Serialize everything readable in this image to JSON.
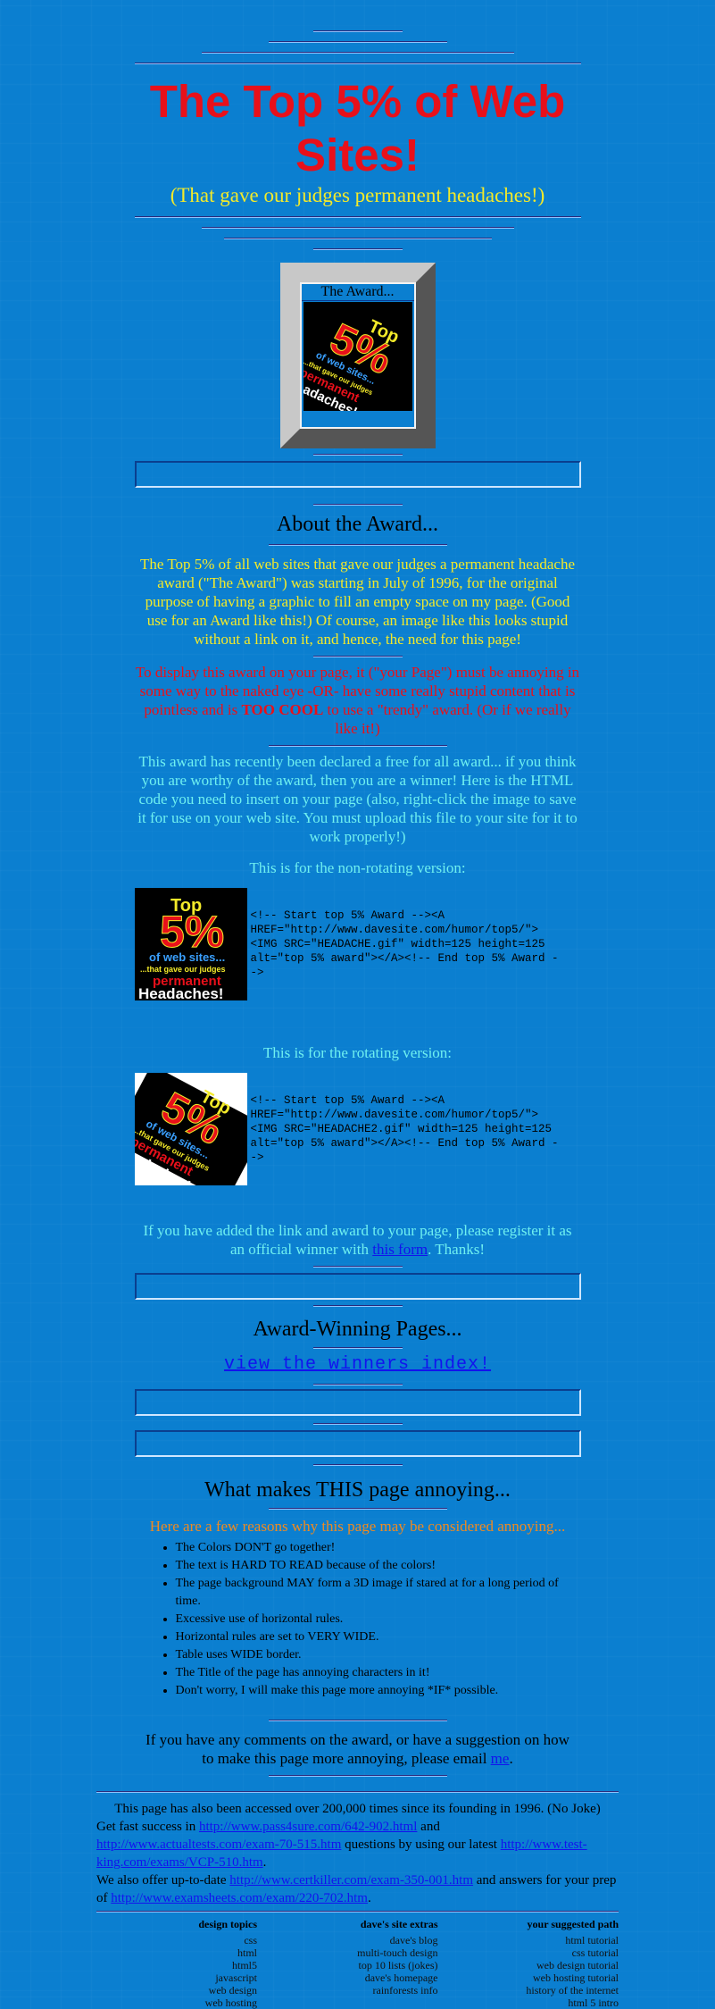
{
  "header": {
    "title": "The Top 5% of Web Sites!",
    "subtitle": "(That gave our judges permanent headaches!)"
  },
  "award_box": {
    "caption": "The Award...",
    "badge_lines": [
      "Top",
      "5%",
      "of web sites...",
      "...that gave our judges",
      "permanent",
      "Headaches!"
    ]
  },
  "about": {
    "heading": "About the Award...",
    "para1": "The Top 5% of all web sites that gave our judges a permanent headache award (\"The Award\") was starting in July of 1996, for the original purpose of having a graphic to fill an empty space on my page. (Good use for an Award like this!) Of course, an image like this looks stupid without a link on it, and hence, the need for this page!",
    "para2_before": "To display this award on your page, it (\"your Page\") must be annoying in some way to the naked eye -OR- have some really stupid content that is pointless and is ",
    "para2_bold": "TOO COOL",
    "para2_after": " to use a \"trendy\" award. (Or if we really like it!)",
    "para3": "This award has recently been declared a free for all award... if you think you are worthy of the award, then you are a winner! Here is the HTML code you need to insert on your page (also, right-click the image to save it for use on your web site. You must upload this file to your site for it to work properly!)",
    "nonrot_label": "This is for the non-rotating version:",
    "nonrot_code": "<!-- Start top 5% Award --><A HREF=\"http://www.davesite.com/humor/top5/\"><IMG SRC=\"HEADACHE.gif\" width=125 height=125 alt=\"top 5% award\"></A><!-- End top 5% Award -->",
    "rot_label": "This is for the rotating version:",
    "rot_code": "<!-- Start top 5% Award --><A HREF=\"http://www.davesite.com/humor/top5/\"><IMG SRC=\"HEADACHE2.gif\" width=125 height=125 alt=\"top 5% award\"></A><!-- End top 5% Award -->",
    "register_before": "If you have added the link and award to your page, please register it as an official winner with ",
    "register_link": "this form",
    "register_after": ". Thanks!"
  },
  "winners": {
    "heading": "Award-Winning Pages...",
    "link": "view the winners index!"
  },
  "annoying": {
    "heading": "What makes THIS page annoying...",
    "intro": "Here are a few reasons why this page may be considered annoying...",
    "reasons": [
      "The Colors DON'T go together!",
      "The text is HARD TO READ because of the colors!",
      "The page background MAY form a 3D image if stared at for a long period of time.",
      "Excessive use of horizontal rules.",
      "Horizontal rules are set to VERY WIDE.",
      "Table uses WIDE border.",
      "The Title of the page has annoying characters in it!",
      "Don't worry, I will make this page more annoying *IF* possible."
    ],
    "comments_before": "If you have any comments on the award, or have a suggestion on how to make this page more annoying, please email ",
    "comments_link": "me",
    "comments_after": "."
  },
  "footer": {
    "access": "This page has also been accessed over 200,000 times since its founding in 1996. (No Joke)",
    "l1_a": "Get fast success in ",
    "l1_link1": "http://www.pass4sure.com/642-902.html",
    "l1_b": " and ",
    "l1_link2": "http://www.actualtests.com/exam-70-515.htm",
    "l1_c": " questions by using our latest ",
    "l1_link3": "http://www.test-king.com/exams/VCP-510.htm",
    "l1_d": ".",
    "l2_a": "We also offer up-to-date ",
    "l2_link1": "http://www.certkiller.com/exam-350-001.htm",
    "l2_b": " and answers for your prep of ",
    "l2_link2": "http://www.examsheets.com/exam/220-702.htm",
    "l2_c": "."
  },
  "bottom_links": {
    "col1": {
      "heading": "design topics",
      "items": [
        "css",
        "html",
        "html5",
        "javascript",
        "web design",
        "web hosting"
      ]
    },
    "col2": {
      "heading": "dave's site extras",
      "items": [
        "dave's blog",
        "multi-touch design",
        "top 10 lists (jokes)",
        "dave's homepage",
        "rainforests info"
      ]
    },
    "col3": {
      "heading": "your suggested path",
      "items": [
        "html tutorial",
        "css tutorial",
        "web design tutorial",
        "web hosting tutorial",
        "history of the internet",
        "html 5 intro"
      ]
    }
  },
  "colors": {
    "background": "#0b7fd0",
    "title": "#e8101a",
    "subtitle": "#f3ea2a",
    "cyan": "#6ff0f0",
    "orange": "#f08a20"
  }
}
